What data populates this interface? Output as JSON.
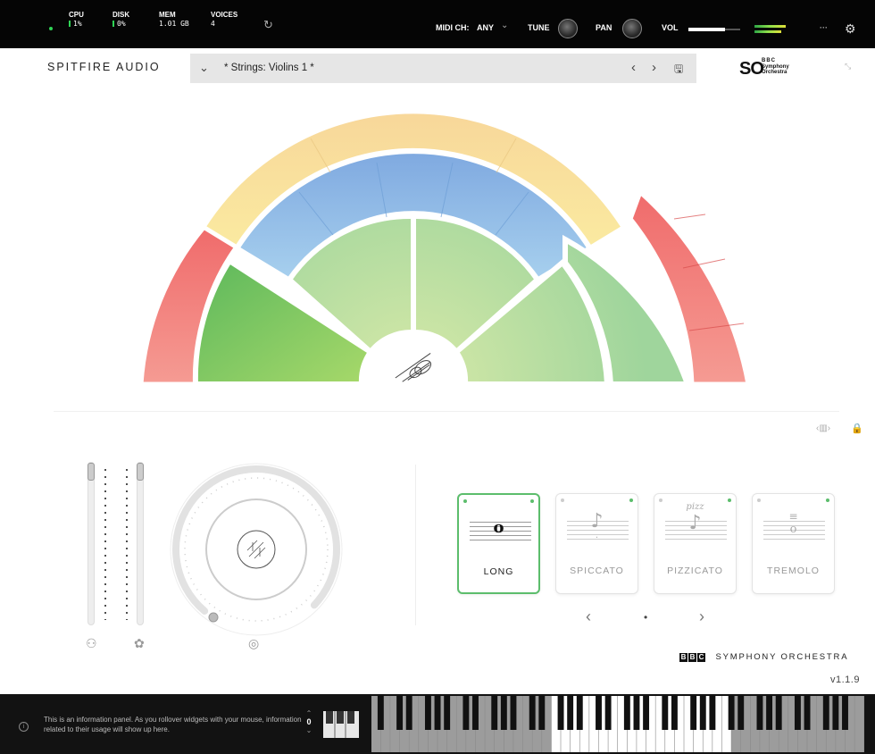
{
  "topbar": {
    "cpu": {
      "label": "CPU",
      "value": "1%"
    },
    "disk": {
      "label": "DISK",
      "value": "0%"
    },
    "mem": {
      "label": "MEM",
      "value": "1.01 GB"
    },
    "voices": {
      "label": "VOICES",
      "value": "4"
    },
    "midi_label": "MIDI CH:",
    "midi_value": "ANY",
    "tune_label": "TUNE",
    "pan_label": "PAN",
    "vol_label": "VOL",
    "vol_level": 0.7,
    "menu": "···"
  },
  "header": {
    "brand": "SPITFIRE AUDIO",
    "preset_name": "* Strings: Violins 1 *",
    "logo_text": "SO",
    "logo_sub": [
      "BBC",
      "Symphony",
      "Orchestra"
    ]
  },
  "articulations": [
    {
      "label": "LONG",
      "active": true
    },
    {
      "label": "SPICCATO",
      "active": false
    },
    {
      "label": "PIZZICATO",
      "active": false,
      "marking": "pizz"
    },
    {
      "label": "TREMOLO",
      "active": false
    }
  ],
  "footer_brand": {
    "boxes": [
      "B",
      "B",
      "C"
    ],
    "text": "SYMPHONY ORCHESTRA"
  },
  "version": "v1.1.9",
  "info_panel": "This is an information panel. As you rollover widgets with your mouse, information related to their usage will show up here.",
  "octave": "0",
  "colors": {
    "green": "#5cbd6c",
    "red": "#ee7f7b",
    "blue": "#89b6e3",
    "yellow": "#f9dd98",
    "meter": "#2fd455"
  }
}
